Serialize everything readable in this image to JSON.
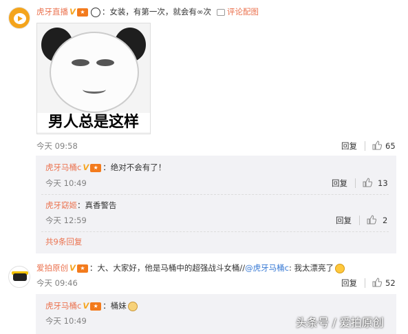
{
  "comments": [
    {
      "user": "虎牙直播",
      "text": "：女装，有第一次，就会有∞次",
      "pic_link": "评论配图",
      "image_caption": "男人总是这样",
      "time": "今天 09:58",
      "reply_label": "回复",
      "likes": "65"
    },
    {
      "user": "爱拍原创",
      "text": "：大、大家好，他是马桶中的超强战斗女桶//",
      "mention": "@虎牙马桶c",
      "text2": ": 我太漂亮了",
      "time": "今天 09:46",
      "reply_label": "回复",
      "likes": "52"
    }
  ],
  "replies": [
    {
      "user": "虎牙马桶c",
      "text": "：绝对不会有了！",
      "time": "今天 10:49",
      "reply_label": "回复",
      "likes": "13"
    },
    {
      "user": "虎牙窈姬",
      "text": "：真香警告",
      "time": "今天 12:59",
      "reply_label": "回复",
      "likes": "2"
    },
    {
      "user": "虎牙马桶c",
      "text": "：桶妹",
      "time": "今天 10:49"
    }
  ],
  "more_replies": "共9条回复",
  "watermark": "头条号 / 爱拍原创",
  "colors": {
    "username": "#eb7350",
    "link_blue": "#3a7bd5",
    "reply_bg": "#f2f2f5"
  }
}
